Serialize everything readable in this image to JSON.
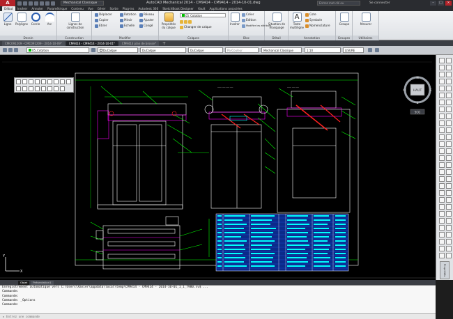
{
  "title_bar": {
    "workspace": "Mechanical Classique",
    "title": "AutoCAD Mechanical 2014 - CM9414 - CM9414 - 2014-10-01.dwg",
    "search_placeholder": "Entrez mot-clé ou expression",
    "signin": "Se connecter"
  },
  "ribbon_tabs": [
    "Début",
    "Insérer",
    "Annoter",
    "Paramétrique",
    "Contenu",
    "Vue",
    "Gérer",
    "Sortie",
    "Plug-ins",
    "Autodesk 360",
    "SketchBook Designer",
    "Vault",
    "Applications associées"
  ],
  "ribbon": {
    "dessin": {
      "title": "Dessin",
      "buttons": [
        "Ligne",
        "Polyligne",
        "Cercle",
        "Arc"
      ]
    },
    "construction": {
      "title": "Construction",
      "button": "Lignes de construction"
    },
    "modifier": {
      "title": "Modifier",
      "items": [
        "Déplacer",
        "Rotation",
        "Copier",
        "Miroir",
        "Etirer",
        "Echelle",
        "Réseau",
        "Ajuster",
        "Congé"
      ]
    },
    "calques": {
      "title": "Calques",
      "layer": "05_Cotation",
      "buttons": [
        "Propriétés du calque",
        "Changer de calque"
      ]
    },
    "bloc": {
      "title": "Bloc",
      "buttons": [
        "Insérer",
        "Créer",
        "Edition",
        "Modifier les attributs"
      ]
    },
    "detail": {
      "title": "Détail",
      "button": "Situation de masquage"
    },
    "annotation": {
      "title": "Annotation",
      "buttons": [
        "Texte multiligne",
        "Cote",
        "Symbole",
        "Nomenclature"
      ]
    },
    "groupes": {
      "title": "Groupes",
      "button": "Groupe"
    },
    "utilitaires": {
      "title": "Utilitaires",
      "button": "Mesurer"
    }
  },
  "doc_tabs": [
    "CMC091209 - CMC091209 - 2014-10-09*",
    "CM9414 - CM9414 - 2014-10-01*",
    "CM9413 plan de brosse*"
  ],
  "props_bar": {
    "layer": "05_Cotation",
    "color": "DuCalque",
    "linetype": "DuCalque",
    "lineweight": "DuCalque",
    "plotstyle": "ParCouleur",
    "style": "Mechanical Classique",
    "scale": "1:10",
    "unit": "LISURE"
  },
  "viewcube": {
    "face": "HAUT",
    "north": "N",
    "south": "S",
    "east": "E",
    "west": "O",
    "wcs": "SCG"
  },
  "layout_tabs": [
    "Objet",
    "Présentation1"
  ],
  "command_history": [
    "Enregistrement automatique vers C:\\Users\\Xavier\\appdata\\local\\temp\\CM9414 - CM9414 - 2014-10-01_1_1_7980.sv$ ...",
    "Commande:",
    "Commande:",
    "Commande: _Options",
    "Commande:"
  ],
  "command_placeholder": "Entrez une commande",
  "palette_label": "Propriétés",
  "colors": {
    "accent": "#b4232a",
    "drawing_white": "#ffffff",
    "drawing_green": "#00ff00",
    "drawing_magenta": "#ff00ff",
    "drawing_cyan": "#00ffff",
    "drawing_red": "#ff2020",
    "drawing_yellow": "#ffff00",
    "table_blue": "#1a50e0"
  }
}
